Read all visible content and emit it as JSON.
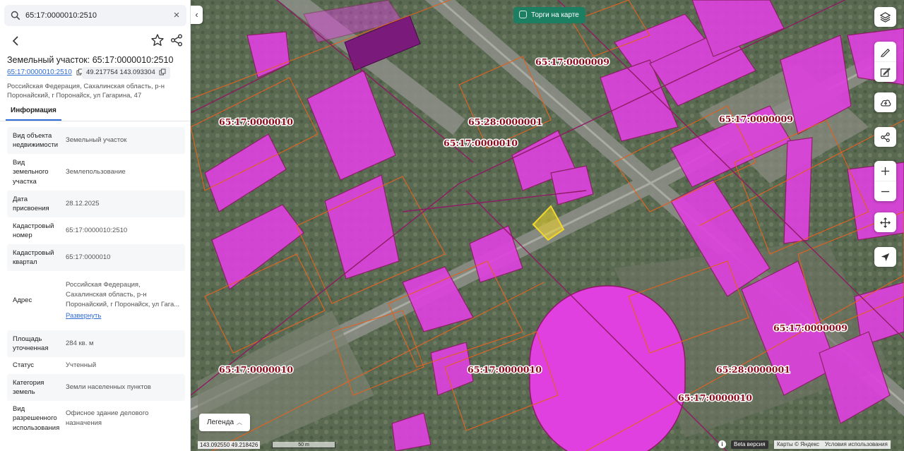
{
  "search": {
    "value": "65:17:0000010:2510"
  },
  "object": {
    "title": "Земельный участок: 65:17:0000010:2510",
    "cad_number": "65:17:0000010:2510",
    "coords": "49.217754 143.093304",
    "address": "Российская Федерация, Сахалинская область, р-н Поронайский, г Поронайск, ул Гагарина, 47"
  },
  "tabs": [
    {
      "label": "Информация"
    }
  ],
  "properties": [
    {
      "key": "Вид объекта недвижимости",
      "value": "Земельный участок"
    },
    {
      "key": "Вид земельного участка",
      "value": "Землепользование"
    },
    {
      "key": "Дата присвоения",
      "value": "28.12.2025"
    },
    {
      "key": "Кадастровый номер",
      "value": "65:17:0000010:2510"
    },
    {
      "key": "Кадастровый квартал",
      "value": "65:17:0000010"
    },
    {
      "key": "Адрес",
      "value": "Российская Федерация, Сахалинская область, р-н Поронайский, г Поронайск, ул Гага...",
      "link": "Развернуть"
    },
    {
      "key": "Площадь уточненная",
      "value": "284 кв. м"
    },
    {
      "key": "Статус",
      "value": "Учтенный"
    },
    {
      "key": "Категория земель",
      "value": "Земли населенных пунктов"
    },
    {
      "key": "Вид разрешенного использования",
      "value": "Офисное здание делового назначения"
    }
  ],
  "map": {
    "torgi_label": "Торги на карте",
    "legend_label": "Легенда",
    "coords": "143.092550  49.218426",
    "scale_label": "50 m",
    "beta_label": "Beta версия",
    "attribution": [
      "Карты © Яндекс",
      "Условия использования"
    ],
    "quarter_labels": [
      "65:17:0000009",
      "65:17:0000010",
      "65:28:0000001",
      "65:17:0000010",
      "65:17:0000009",
      "65:17:0000009",
      "65:17:0000010",
      "65:17:0000010",
      "65:28:0000001",
      "65:17:0000010"
    ],
    "colors": {
      "parcel": "#e040e0",
      "boundary": "#e2611e",
      "quarter": "#8e1b63",
      "selected": "#f2d72a"
    }
  }
}
